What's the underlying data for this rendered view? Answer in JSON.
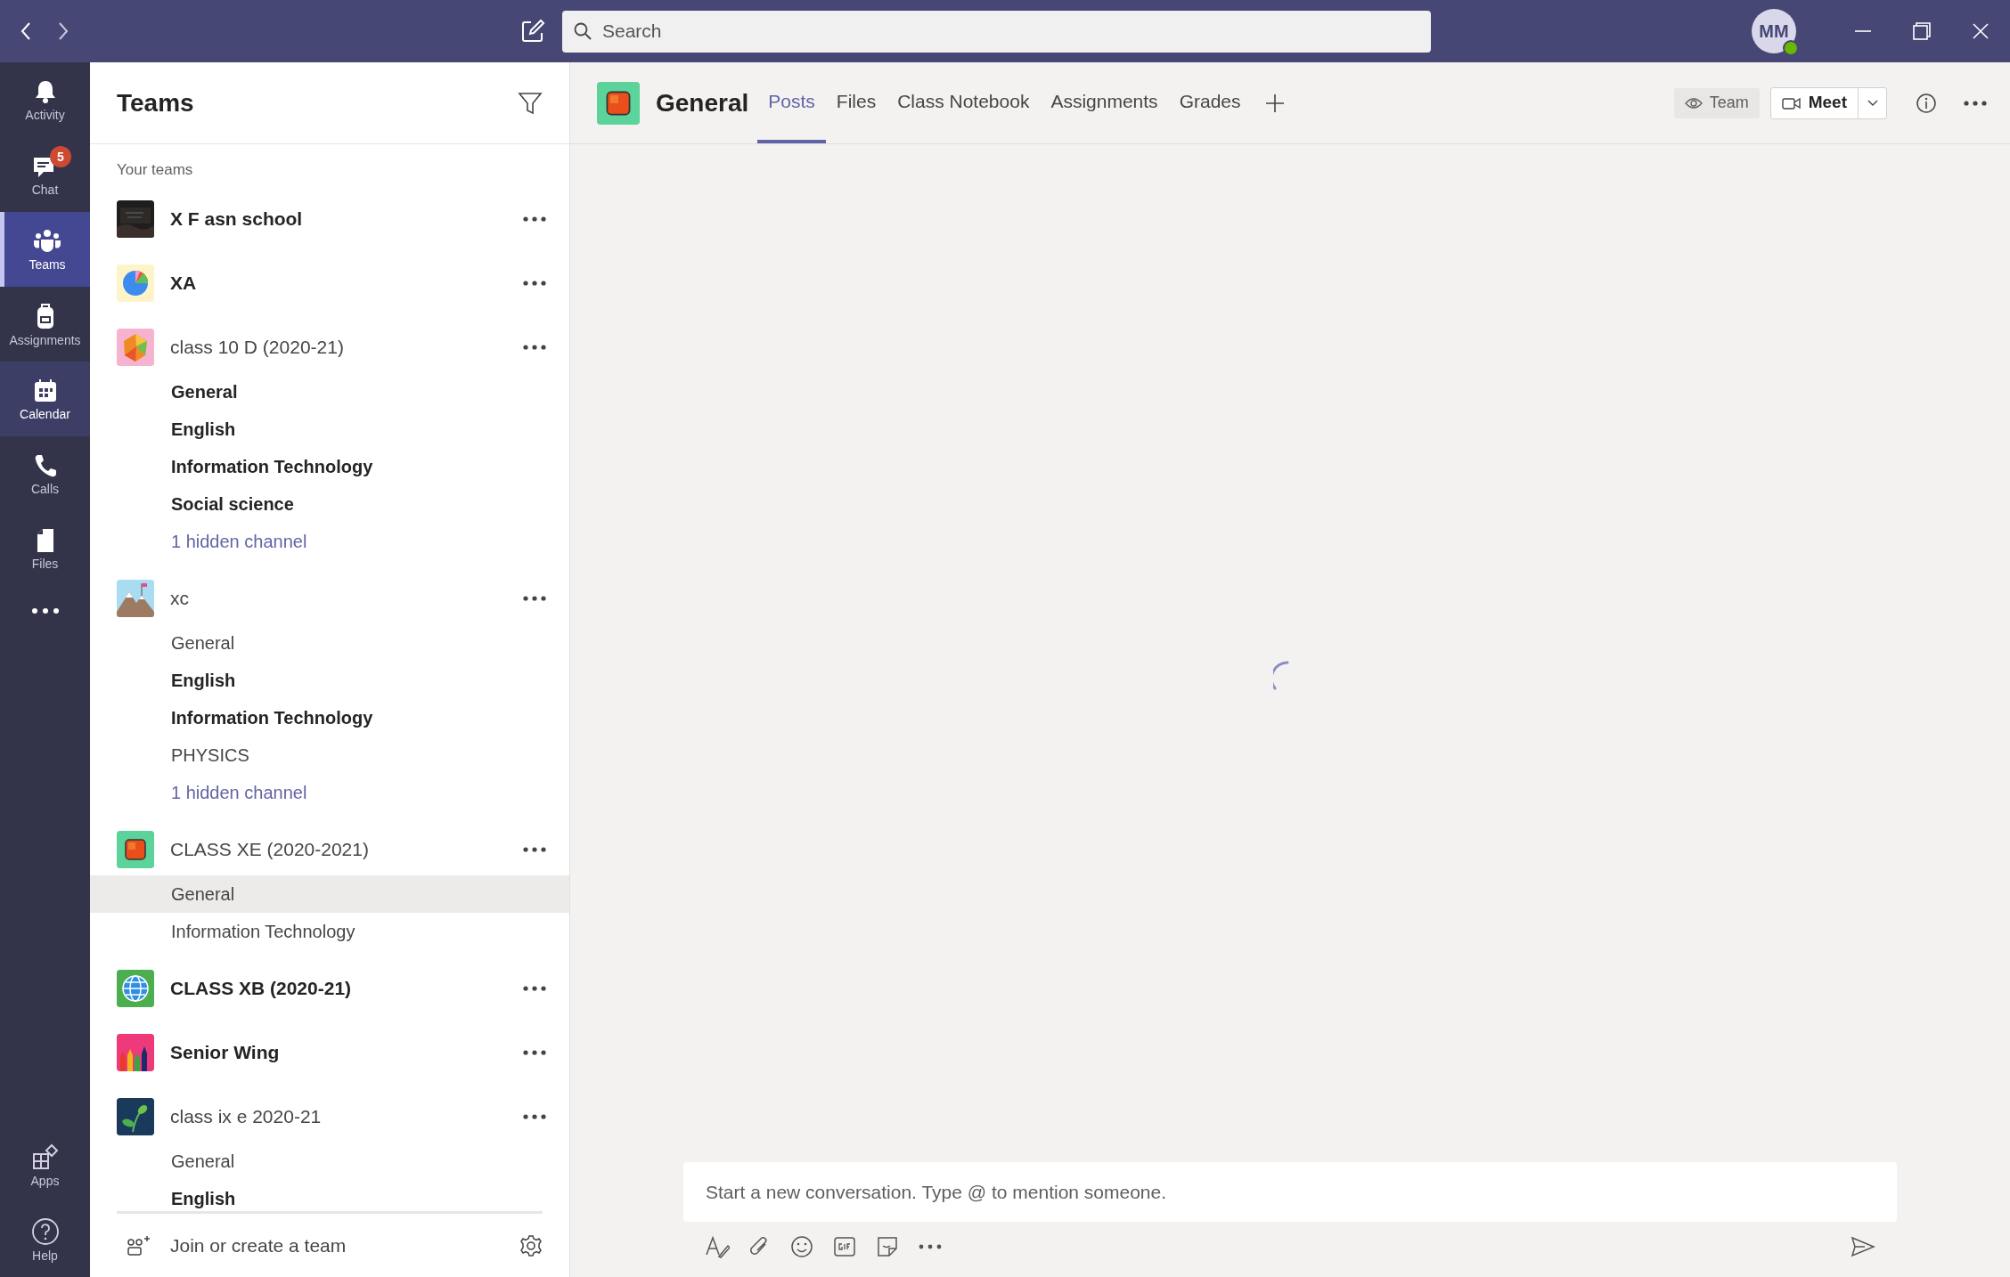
{
  "title_bar": {
    "search": {
      "placeholder": "Search"
    },
    "avatar": {
      "initials": "MM"
    }
  },
  "app_bar": [
    {
      "label": "Activity",
      "selected": false,
      "hovered": false
    },
    {
      "label": "Chat",
      "badge": "5",
      "selected": false,
      "hovered": false
    },
    {
      "label": "Teams",
      "selected": true,
      "hovered": false
    },
    {
      "label": "Assignments",
      "selected": false,
      "hovered": false
    },
    {
      "label": "Calendar",
      "selected": false,
      "hovered": true
    },
    {
      "label": "Calls",
      "selected": false,
      "hovered": false
    },
    {
      "label": "Files",
      "selected": false,
      "hovered": false
    }
  ],
  "app_bar_bottom": [
    {
      "label": "Apps"
    },
    {
      "label": "Help"
    }
  ],
  "teams_panel": {
    "title": "Teams",
    "section_label": "Your teams",
    "teams": [
      {
        "name": "X F asn school",
        "unread": true
      },
      {
        "name": "XA",
        "unread": true
      },
      {
        "name": "class 10 D (2020-21)",
        "unread": false,
        "channels": [
          {
            "kind": "channel",
            "name": "General",
            "unread": true,
            "selected": false
          },
          {
            "kind": "channel",
            "name": "English",
            "unread": true,
            "selected": false
          },
          {
            "kind": "channel",
            "name": "Information Technology",
            "unread": true,
            "selected": false
          },
          {
            "kind": "channel",
            "name": "Social science",
            "unread": true,
            "selected": false
          },
          {
            "kind": "hidden",
            "name": "1 hidden channel",
            "selected": false
          }
        ]
      },
      {
        "name": "xc",
        "unread": false,
        "channels": [
          {
            "kind": "channel",
            "name": "General",
            "unread": false,
            "selected": false
          },
          {
            "kind": "channel",
            "name": "English",
            "unread": true,
            "selected": false
          },
          {
            "kind": "channel",
            "name": "Information Technology",
            "unread": true,
            "selected": false
          },
          {
            "kind": "channel",
            "name": "PHYSICS",
            "unread": false,
            "selected": false
          },
          {
            "kind": "hidden",
            "name": "1 hidden channel",
            "selected": false
          }
        ]
      },
      {
        "name": "CLASS XE (2020-2021)",
        "unread": false,
        "channels": [
          {
            "kind": "channel",
            "name": "General",
            "unread": false,
            "selected": true
          },
          {
            "kind": "channel",
            "name": "Information Technology",
            "unread": false,
            "selected": false
          }
        ]
      },
      {
        "name": "CLASS XB (2020-21)",
        "unread": true
      },
      {
        "name": "Senior Wing",
        "unread": true
      },
      {
        "name": "class ix e 2020-21",
        "unread": false,
        "channels": [
          {
            "kind": "channel",
            "name": "General",
            "unread": false,
            "selected": false
          },
          {
            "kind": "channel",
            "name": "English",
            "unread": true,
            "selected": false
          }
        ]
      }
    ],
    "footer": {
      "label": "Join or create a team"
    }
  },
  "channel_header": {
    "title": "General",
    "tabs": [
      {
        "label": "Posts",
        "selected": true
      },
      {
        "label": "Files",
        "selected": false
      },
      {
        "label": "Class Notebook",
        "selected": false
      },
      {
        "label": "Assignments",
        "selected": false
      },
      {
        "label": "Grades",
        "selected": false
      }
    ],
    "team_button": "Team",
    "meet_button": "Meet"
  },
  "loading": true,
  "compose": {
    "placeholder": "Start a new conversation. Type @ to mention someone."
  }
}
